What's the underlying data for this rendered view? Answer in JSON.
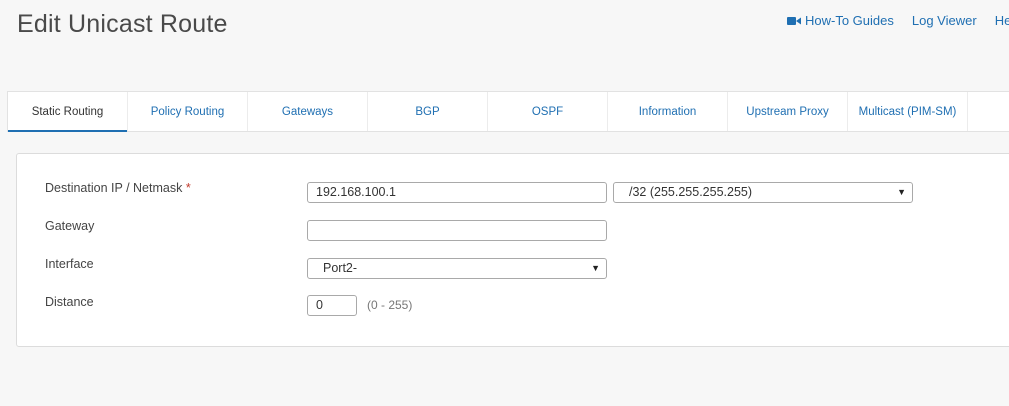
{
  "header": {
    "title": "Edit Unicast Route",
    "links": [
      {
        "label": "How-To Guides",
        "icon": "video-camera-icon"
      },
      {
        "label": "Log Viewer"
      },
      {
        "label": "He"
      }
    ]
  },
  "tabs": [
    {
      "label": "Static Routing",
      "active": true
    },
    {
      "label": "Policy Routing"
    },
    {
      "label": "Gateways"
    },
    {
      "label": "BGP"
    },
    {
      "label": "OSPF"
    },
    {
      "label": "Information"
    },
    {
      "label": "Upstream Proxy"
    },
    {
      "label": "Multicast (PIM-SM)"
    }
  ],
  "form": {
    "destination": {
      "label": "Destination IP / Netmask",
      "required_mark": "*",
      "ip_value": "192.168.100.1",
      "netmask_value": "/32 (255.255.255.255)"
    },
    "gateway": {
      "label": "Gateway",
      "value": ""
    },
    "interface": {
      "label": "Interface",
      "value": "Port2-"
    },
    "distance": {
      "label": "Distance",
      "value": "0",
      "range_hint": "(0 - 255)"
    }
  },
  "colors": {
    "accent": "#1f6fb2",
    "required": "#c0392b"
  }
}
